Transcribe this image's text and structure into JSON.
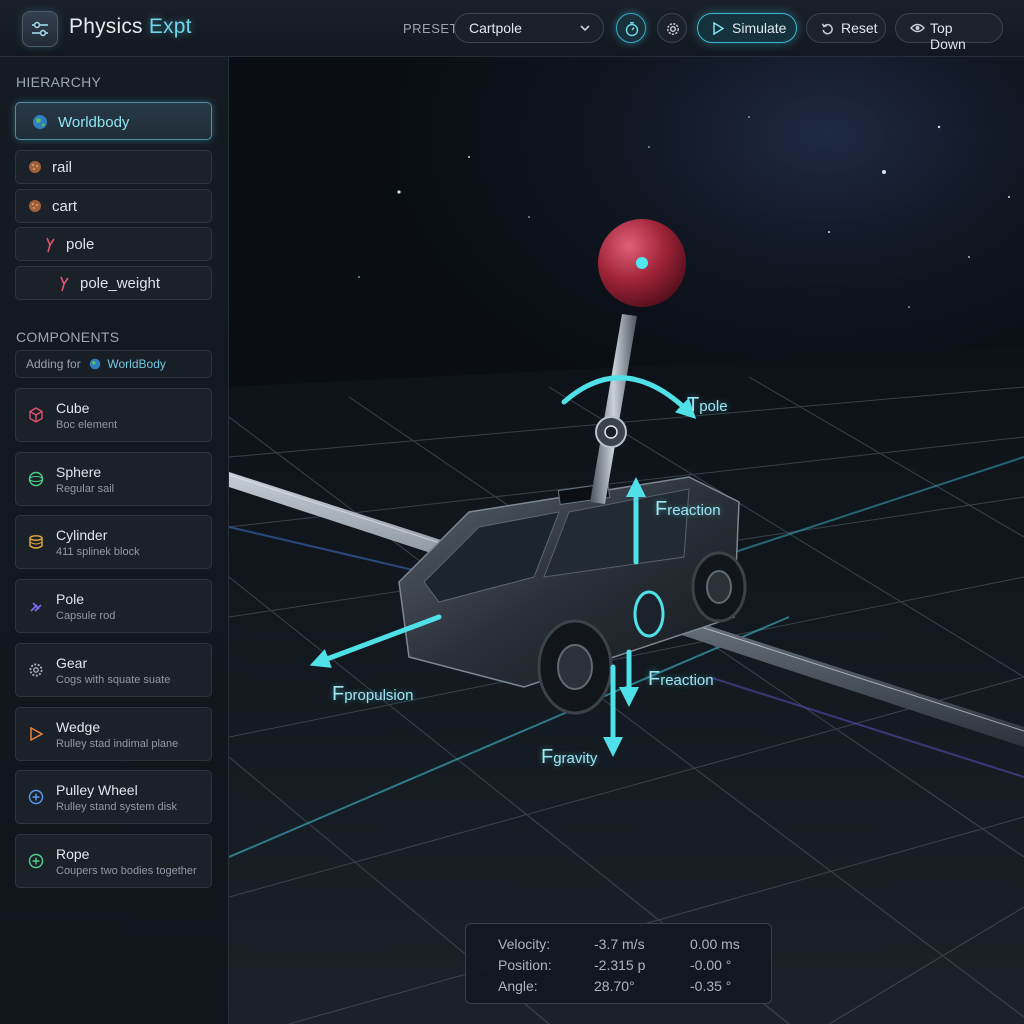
{
  "app": {
    "title_main": "Physics",
    "title_accent": "Expt"
  },
  "toolbar": {
    "preset_label": "PRESET:",
    "preset_value": "Cartpole",
    "simulate_label": "Simulate",
    "reset_label": "Reset",
    "view_label": "Top Down"
  },
  "sidebar": {
    "hierarchy_title": "HIERARCHY",
    "hierarchy": [
      {
        "label": "Worldbody",
        "icon": "globe-icon",
        "selected": true
      },
      {
        "label": "rail",
        "icon": "body-icon"
      },
      {
        "label": "cart",
        "icon": "body-icon"
      },
      {
        "label": "pole",
        "icon": "joint-icon"
      },
      {
        "label": "pole_weight",
        "icon": "joint-icon"
      }
    ],
    "components_title": "COMPONENTS",
    "adding_prefix": "Adding for",
    "adding_target": "WorldBody",
    "components": [
      {
        "name": "Cube",
        "desc": "Boc element",
        "icon": "cube-icon",
        "color": "#e0526e"
      },
      {
        "name": "Sphere",
        "desc": "Regular sail",
        "icon": "sphere-icon",
        "color": "#4fd08a"
      },
      {
        "name": "Cylinder",
        "desc": "411 splinek block",
        "icon": "cylinder-icon",
        "color": "#e6a935"
      },
      {
        "name": "Pole",
        "desc": "Capsule rod",
        "icon": "pole-icon",
        "color": "#7b6cf0"
      },
      {
        "name": "Gear",
        "desc": "Cogs with squate suate",
        "icon": "gear-icon",
        "color": "#a8b3bf"
      },
      {
        "name": "Wedge",
        "desc": "Rulley stad indimal plane",
        "icon": "wedge-icon",
        "color": "#e8823a"
      },
      {
        "name": "Pulley Wheel",
        "desc": "Rulley stand system disk",
        "icon": "pulley-icon",
        "color": "#5a9af0"
      },
      {
        "name": "Rope",
        "desc": "Coupers two bodies together",
        "icon": "rope-icon",
        "color": "#4fd08a"
      }
    ]
  },
  "viewport": {
    "forces": {
      "torque_pole": {
        "main": "T",
        "sub": "pole"
      },
      "reaction_top": {
        "main": "F",
        "sub": "reaction"
      },
      "reaction_bottom": {
        "main": "F",
        "sub": "reaction"
      },
      "propulsion": {
        "main": "F",
        "sub": "propulsion"
      },
      "gravity": {
        "main": "F",
        "sub": "gravity"
      }
    }
  },
  "readout": {
    "rows": [
      {
        "label": "Velocity:",
        "v1": "-3.7 m/s",
        "v2": "0.00 ms"
      },
      {
        "label": "Position:",
        "v1": "-2.315 p",
        "v2": "-0.00 °"
      },
      {
        "label": "Angle:",
        "v1": "28.70°",
        "v2": "-0.35 °"
      }
    ]
  },
  "colors": {
    "accent": "#5fd3e8",
    "force_arrow": "#4fe0e8",
    "pole_ball": "#b0283e"
  }
}
